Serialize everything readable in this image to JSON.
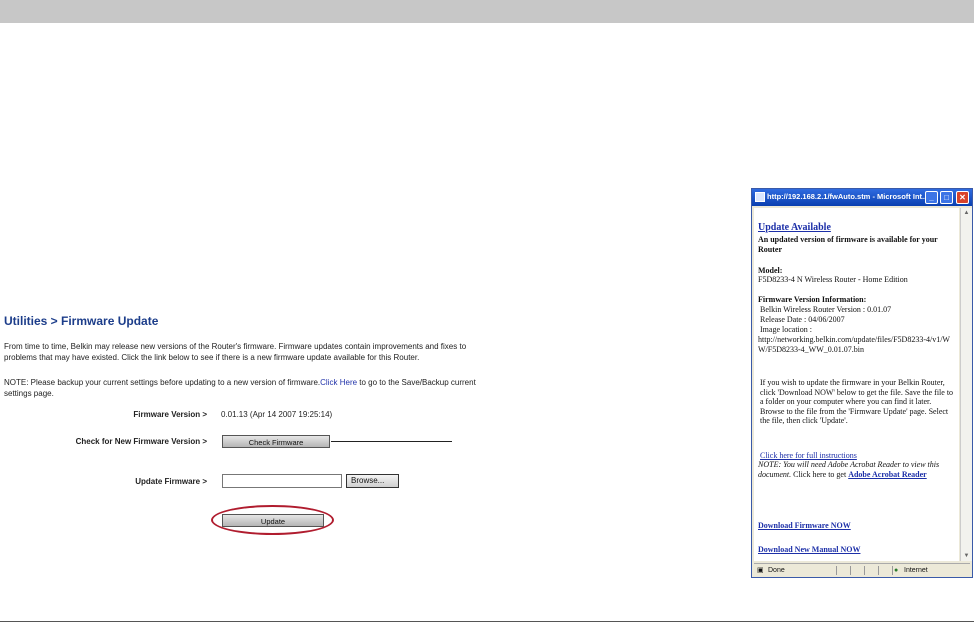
{
  "page": {
    "title": "Utilities > Firmware Update",
    "intro": "From time to time, Belkin may release new versions of the Router's firmware. Firmware updates contain improvements and fixes to problems that may have existed. Click the link below to see if there is a new firmware update available for this Router.",
    "note_prefix": "NOTE: Please backup your current settings before updating to a new version of firmware.",
    "note_link": "Click Here",
    "note_suffix": " to go to the Save/Backup current settings page."
  },
  "form": {
    "firmware_version_label": "Firmware Version >",
    "firmware_version_value": "0.01.13 (Apr 14 2007 19:25:14)",
    "check_label": "Check for New Firmware Version >",
    "check_button": "Check Firmware",
    "update_label": "Update Firmware >",
    "file_value": "",
    "browse_button": "Browse...",
    "update_button": "Update"
  },
  "popup": {
    "title": "http://192.168.2.1/fwAuto.stm - Microsoft Int...",
    "heading": "Update Available",
    "subheading": "An updated version of firmware is available for your Router",
    "model_label": "Model:",
    "model_value": "F5D8233-4 N Wireless Router - Home Edition",
    "fw_info_label": "Firmware Version Information:",
    "fw_version": "Belkin Wireless Router Version : 0.01.07",
    "release_date": "Release Date : 04/06/2007",
    "image_location_label": "Image location :",
    "image_location_url": "http://networking.belkin.com/update/files/F5D8233-4/v1/WW/F5D8233-4_WW_0.01.07.bin",
    "instructions": "If you wish to update the firmware in your Belkin Router, click 'Download NOW' below to get the file. Save the file to a folder on your computer where you can find it later. Browse to the file from the 'Firmware Update' page. Select the file, then click 'Update'.",
    "full_instructions_link": "Click here for full instructions",
    "acrobat_note": "NOTE: You will need Adobe Acrobat Reader to view this document.",
    "acrobat_prefix": " Click here to get ",
    "acrobat_link": "Adobe Acrobat Reader",
    "download_firmware": "Download Firmware NOW",
    "download_manual": "Download New Manual NOW",
    "status_done": "Done",
    "status_zone": "Internet"
  }
}
